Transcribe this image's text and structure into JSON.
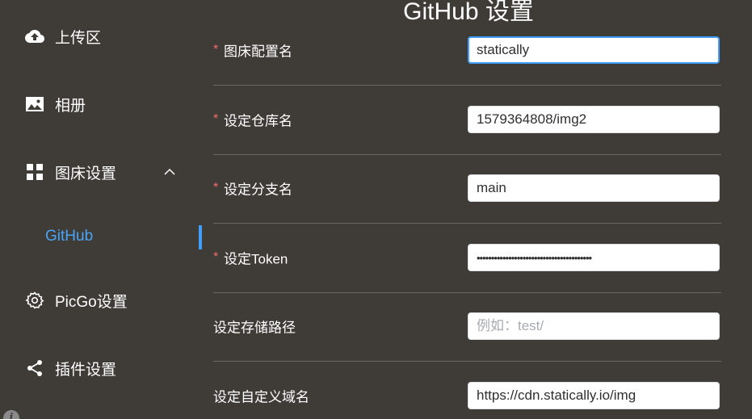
{
  "sidebar": {
    "items": [
      {
        "label": "上传区",
        "icon": "cloud-upload-icon"
      },
      {
        "label": "相册",
        "icon": "image-icon"
      },
      {
        "label": "图床设置",
        "icon": "grid-icon"
      },
      {
        "label": "PicGo设置",
        "icon": "gear-icon"
      },
      {
        "label": "插件设置",
        "icon": "share-icon"
      }
    ],
    "sub_items": [
      {
        "label": "GitHub"
      }
    ]
  },
  "main": {
    "title": "GitHub 设置",
    "fields": [
      {
        "label": "图床配置名",
        "required": true,
        "value": "statically",
        "placeholder": ""
      },
      {
        "label": "设定仓库名",
        "required": true,
        "value": "1579364808/img2",
        "placeholder": ""
      },
      {
        "label": "设定分支名",
        "required": true,
        "value": "main",
        "placeholder": ""
      },
      {
        "label": "设定Token",
        "required": true,
        "value": "••••••••••••••••••••••••••••••••••••••••",
        "placeholder": ""
      },
      {
        "label": "设定存储路径",
        "required": false,
        "value": "",
        "placeholder": "例如：test/"
      },
      {
        "label": "设定自定义域名",
        "required": false,
        "value": "https://cdn.statically.io/img",
        "placeholder": ""
      }
    ]
  },
  "colors": {
    "background": "#3f3c38",
    "accent": "#409eff",
    "required": "#f56c6c"
  }
}
